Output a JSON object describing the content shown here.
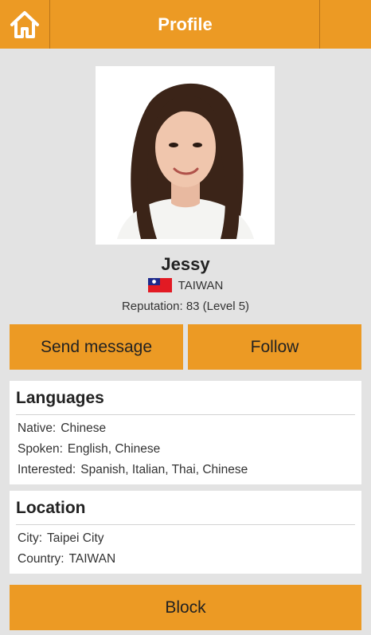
{
  "header": {
    "title": "Profile"
  },
  "icons": {
    "home": "home-icon",
    "flag": "taiwan-flag-icon"
  },
  "colors": {
    "accent": "#ec9a24",
    "background": "#e3e3e3"
  },
  "profile": {
    "name": "Jessy",
    "country": "TAIWAN",
    "reputation": "Reputation: 83 (Level 5)"
  },
  "actions": {
    "send_message": "Send message",
    "follow": "Follow",
    "block": "Block"
  },
  "languages": {
    "title": "Languages",
    "rows": [
      {
        "label": "Native:",
        "value": "Chinese"
      },
      {
        "label": "Spoken:",
        "value": "English, Chinese"
      },
      {
        "label": "Interested:",
        "value": "Spanish, Italian, Thai, Chinese"
      }
    ]
  },
  "location": {
    "title": "Location",
    "rows": [
      {
        "label": "City:",
        "value": "Taipei City"
      },
      {
        "label": "Country:",
        "value": "TAIWAN"
      }
    ]
  }
}
